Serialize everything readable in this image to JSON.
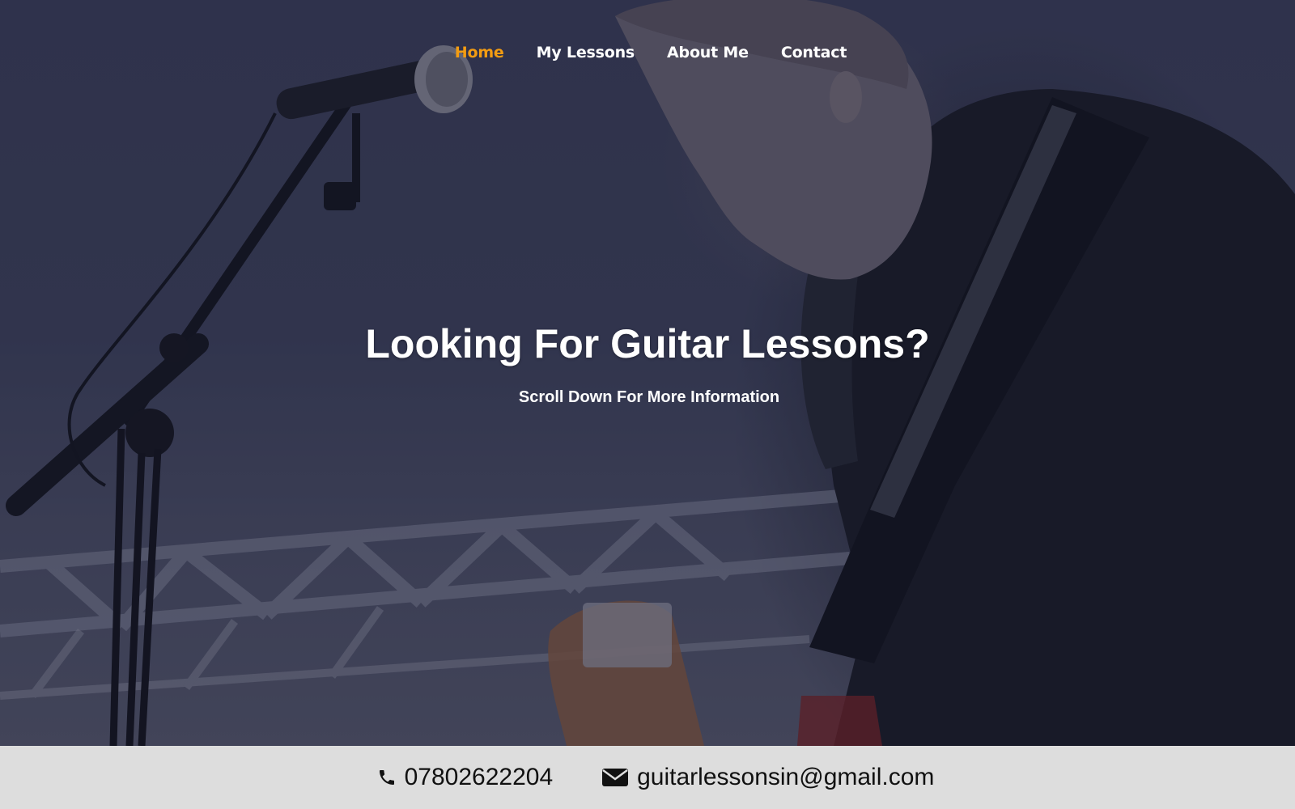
{
  "nav": {
    "items": [
      {
        "label": "Home",
        "active": true
      },
      {
        "label": "My Lessons",
        "active": false
      },
      {
        "label": "About Me",
        "active": false
      },
      {
        "label": "Contact",
        "active": false
      }
    ]
  },
  "hero": {
    "title": "Looking For Guitar Lessons?",
    "subtitle": "Scroll Down For More Information",
    "background_image": "guitarist-with-microphone-photo"
  },
  "contact_bar": {
    "phone": "07802622204",
    "email": "guitarlessonsin@gmail.com",
    "phone_icon": "phone-icon",
    "email_icon": "envelope-icon"
  },
  "colors": {
    "accent": "#f39c12",
    "overlay": "#1c203a",
    "contact_bar_bg": "#dddddd",
    "text_light": "#ffffff"
  }
}
